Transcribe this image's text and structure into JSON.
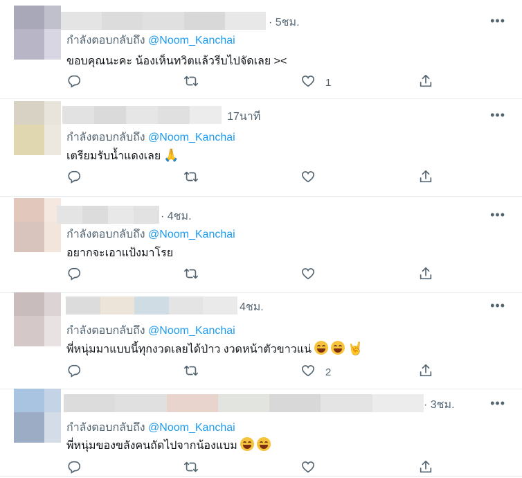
{
  "colors": {
    "accent": "#1d9bf0",
    "muted": "#536471",
    "text": "#0f1419",
    "border": "#e6ecf0"
  },
  "tweets": [
    {
      "time": "· 5ชม.",
      "replying_prefix": "กำลังตอบกลับถึง",
      "mention": "@Noom_Kanchai",
      "text": "ขอบคุณนะคะ น้องเห็นทวิตแล้วรีบไปจัดเลย ><",
      "emojis": [],
      "likes": "1",
      "replies": "",
      "avatar": [
        "#a8a8b8",
        "#c0c0cc",
        "#b8b6c6",
        "#d8d6e2"
      ],
      "name_blocks": [
        "#e4e4e4",
        "#dcdcdc",
        "#e0e0e0",
        "#d8d8d8",
        "#e8e8e8"
      ]
    },
    {
      "time": "17นาที",
      "replying_prefix": "กำลังตอบกลับถึง",
      "mention": "@Noom_Kanchai",
      "text": "เตรียมรับน้ำแดงเลย",
      "emojis": [
        "folded-hands-emoji"
      ],
      "likes": "",
      "replies": "",
      "avatar": [
        "#d8d2c4",
        "#e8e4dc",
        "#e0d6b0",
        "#ece8e0"
      ],
      "name_blocks": [
        "#e2e2e2",
        "#dadada",
        "#e6e6e6",
        "#e0e0e0",
        "#ececec"
      ]
    },
    {
      "time": "· 4ชม.",
      "replying_prefix": "กำลังตอบกลับถึง",
      "mention": "@Noom_Kanchai",
      "text": "อยากจะเอาแป้งมาโรย",
      "emojis": [],
      "likes": "",
      "replies": "",
      "avatar": [
        "#e2c8bc",
        "#f4e8e0",
        "#d8c4bc",
        "#f2e6dc"
      ],
      "name_blocks": [
        "#e4e4e4",
        "#dcdcdc",
        "#e8e8e8",
        "#e2e2e2"
      ]
    },
    {
      "time": "4ชม.",
      "replying_prefix": "กำลังตอบกลับถึง",
      "mention": "@Noom_Kanchai",
      "text": "พี่หนุ่มมาแบบนี้ทุกงวดเลยได้ป่าว งวดหน้าตัวขาวแน่",
      "emojis": [
        "grinning-squint-emoji",
        "grinning-squint-emoji",
        "sign-of-horns-emoji"
      ],
      "likes": "2",
      "replies": "",
      "avatar": [
        "#c8bcbc",
        "#dcd4d4",
        "#d4c8c8",
        "#e8e2e2"
      ],
      "name_blocks": [
        "#dcdcdc",
        "#ece4d8",
        "#d0dce4",
        "#e4e4e4",
        "#eaeaea"
      ]
    },
    {
      "time": "· 3ชม.",
      "replying_prefix": "กำลังตอบกลับถึง",
      "mention": "@Noom_Kanchai",
      "text": "พี่หนุ่มของขลังคนถัดไปจากน้องแบม",
      "emojis": [
        "beaming-face-emoji",
        "beaming-face-emoji"
      ],
      "likes": "",
      "replies": "",
      "avatar": [
        "#a8c4e0",
        "#c4d4e6",
        "#9cacc4",
        "#d4dce8"
      ],
      "name_blocks": [
        "#dcdcdc",
        "#e0e0e0",
        "#e8d4cc",
        "#e2e4e0",
        "#d8d8d8",
        "#e4e4e4",
        "#ececec"
      ]
    }
  ]
}
